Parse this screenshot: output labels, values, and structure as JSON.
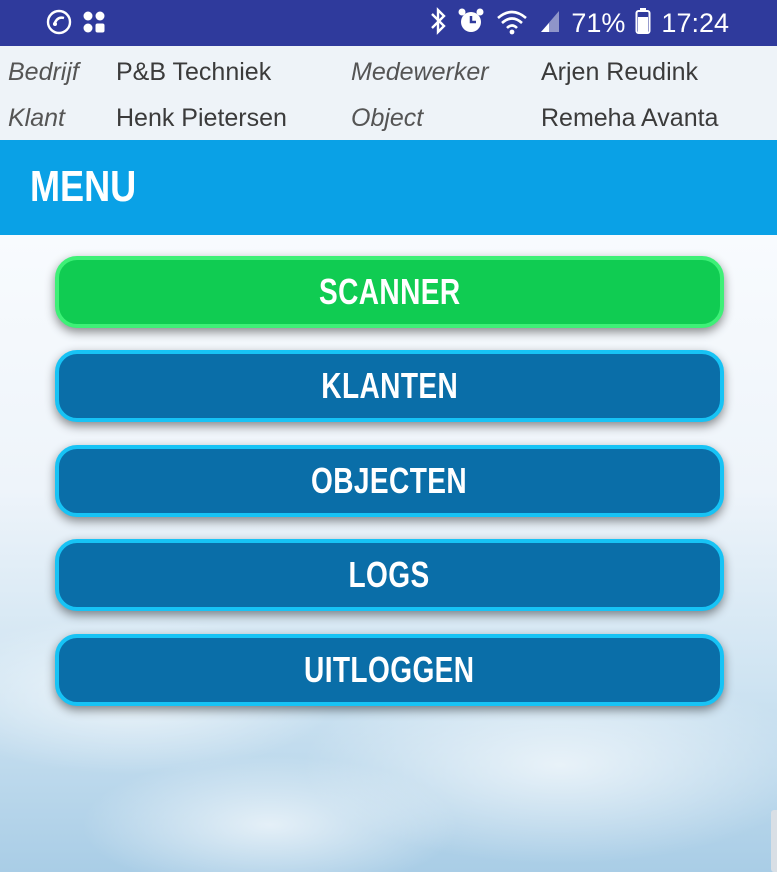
{
  "status_bar": {
    "battery_percent": "71%",
    "time": "17:24",
    "icons_left": [
      "phone-cycle-icon",
      "apps-icon"
    ],
    "icons_right": [
      "bluetooth-icon",
      "alarm-icon",
      "wifi-icon",
      "signal-icon",
      "battery-icon"
    ]
  },
  "info": {
    "company_label": "Bedrijf",
    "company_value": "P&B Techniek",
    "employee_label": "Medewerker",
    "employee_value": "Arjen Reudink",
    "client_label": "Klant",
    "client_value": "Henk Pietersen",
    "object_label": "Object",
    "object_value": "Remeha Avanta"
  },
  "menu": {
    "title": "MENU",
    "buttons": [
      {
        "label": "SCANNER",
        "color": "#10cc52"
      },
      {
        "label": "KLANTEN",
        "color": "#0a6ea8"
      },
      {
        "label": "OBJECTEN",
        "color": "#0a6ea8"
      },
      {
        "label": "LOGS",
        "color": "#0a6ea8"
      },
      {
        "label": "UITLOGGEN",
        "color": "#0a6ea8"
      }
    ]
  },
  "colors": {
    "status_bar": "#2f3a9c",
    "menu_bar": "#0aa1e6",
    "button_border_blue": "#17c3f5",
    "button_border_green": "#3ef077"
  }
}
